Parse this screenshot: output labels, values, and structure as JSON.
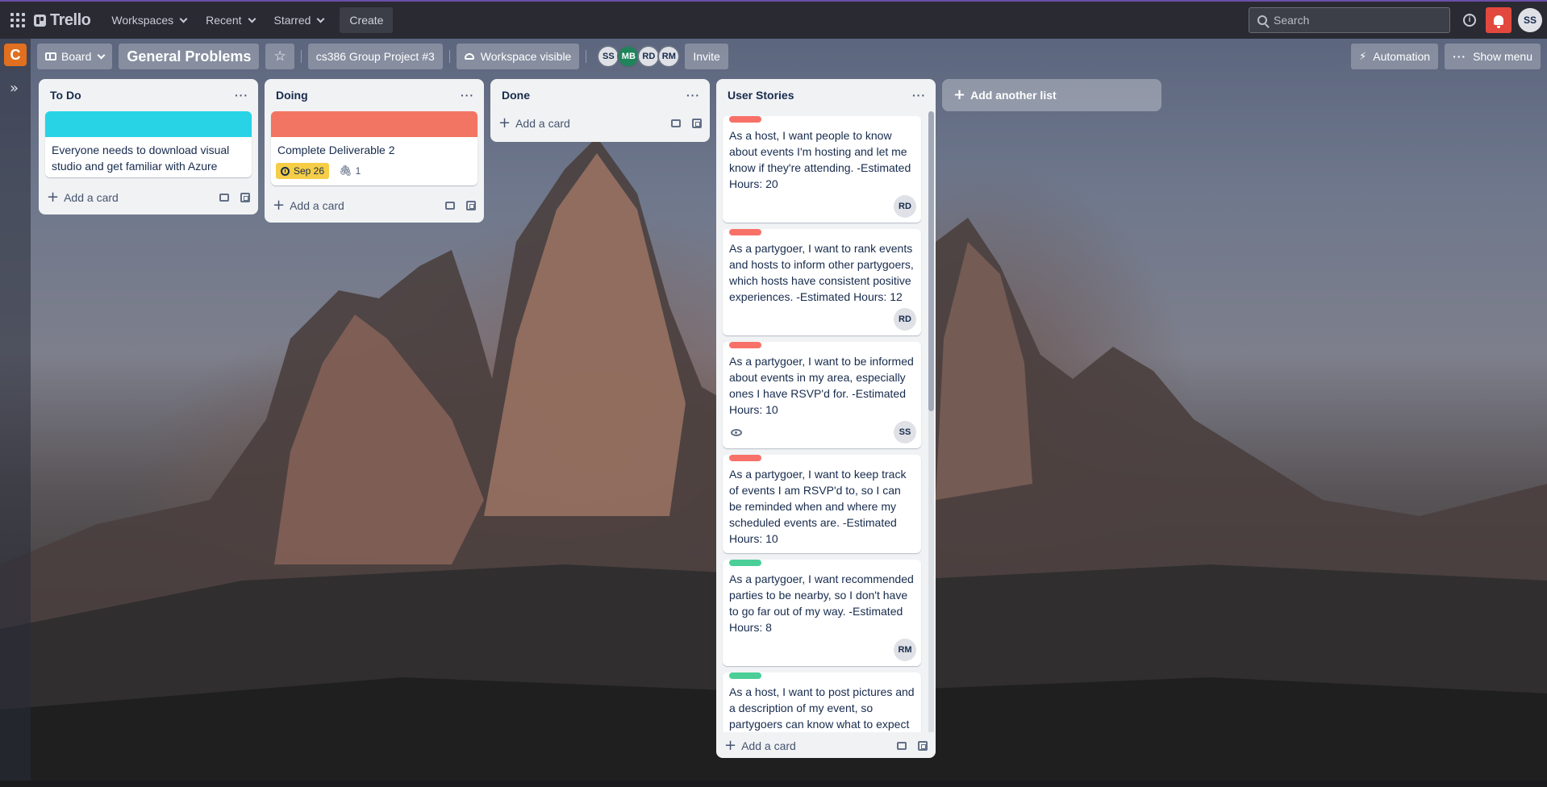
{
  "topbar": {
    "brand": "Trello",
    "nav": [
      "Workspaces",
      "Recent",
      "Starred"
    ],
    "create_label": "Create",
    "search_placeholder": "Search",
    "user_initials": "SS"
  },
  "sidebar": {
    "workspace_letter": "C",
    "expand_glyph": "»"
  },
  "board": {
    "view_label": "Board",
    "title": "General Problems",
    "workspace_name": "cs386 Group Project #3",
    "visibility": "Workspace visible",
    "members": [
      "SS",
      "MB",
      "RD",
      "RM"
    ],
    "invite_label": "Invite",
    "automation_label": "Automation",
    "show_menu_label": "Show menu"
  },
  "lists": [
    {
      "title": "To Do",
      "add_label": "Add a card",
      "cards": [
        {
          "cover": "#29d3e6",
          "text": "Everyone needs to download visual studio and get familiar with Azure"
        }
      ]
    },
    {
      "title": "Doing",
      "add_label": "Add a card",
      "cards": [
        {
          "cover": "#f27564",
          "text": "Complete Deliverable 2",
          "due": "Sep 26",
          "attachments": "1"
        }
      ]
    },
    {
      "title": "Done",
      "add_label": "Add a card",
      "cards": []
    },
    {
      "title": "User Stories",
      "add_label": "Add a card",
      "cards": [
        {
          "label": "red",
          "text": "As a host, I want people to know about events I'm hosting and let me know if they're attending. -Estimated Hours: 20",
          "member": "RD"
        },
        {
          "label": "red",
          "text": "As a partygoer, I want to rank events and hosts to inform other partygoers, which hosts have consistent positive experiences. -Estimated Hours: 12",
          "member": "RD"
        },
        {
          "label": "red",
          "text": "As a partygoer, I want to be informed about events in my area, especially ones I have RSVP'd for. -Estimated Hours: 10",
          "member": "SS",
          "watching": true
        },
        {
          "label": "red",
          "text": "As a partygoer, I want to keep track of events I am RSVP'd to, so I can be reminded when and where my scheduled events are. -Estimated Hours: 10"
        },
        {
          "label": "green",
          "text": "As a partygoer, I want recommended parties to be nearby, so I don't have to go far out of my way. -Estimated Hours: 8",
          "member": "RM"
        },
        {
          "label": "green",
          "text": "As a host, I want to post pictures and a description of my event, so partygoers can know what to expect"
        }
      ]
    }
  ],
  "add_list_label": "Add another list"
}
